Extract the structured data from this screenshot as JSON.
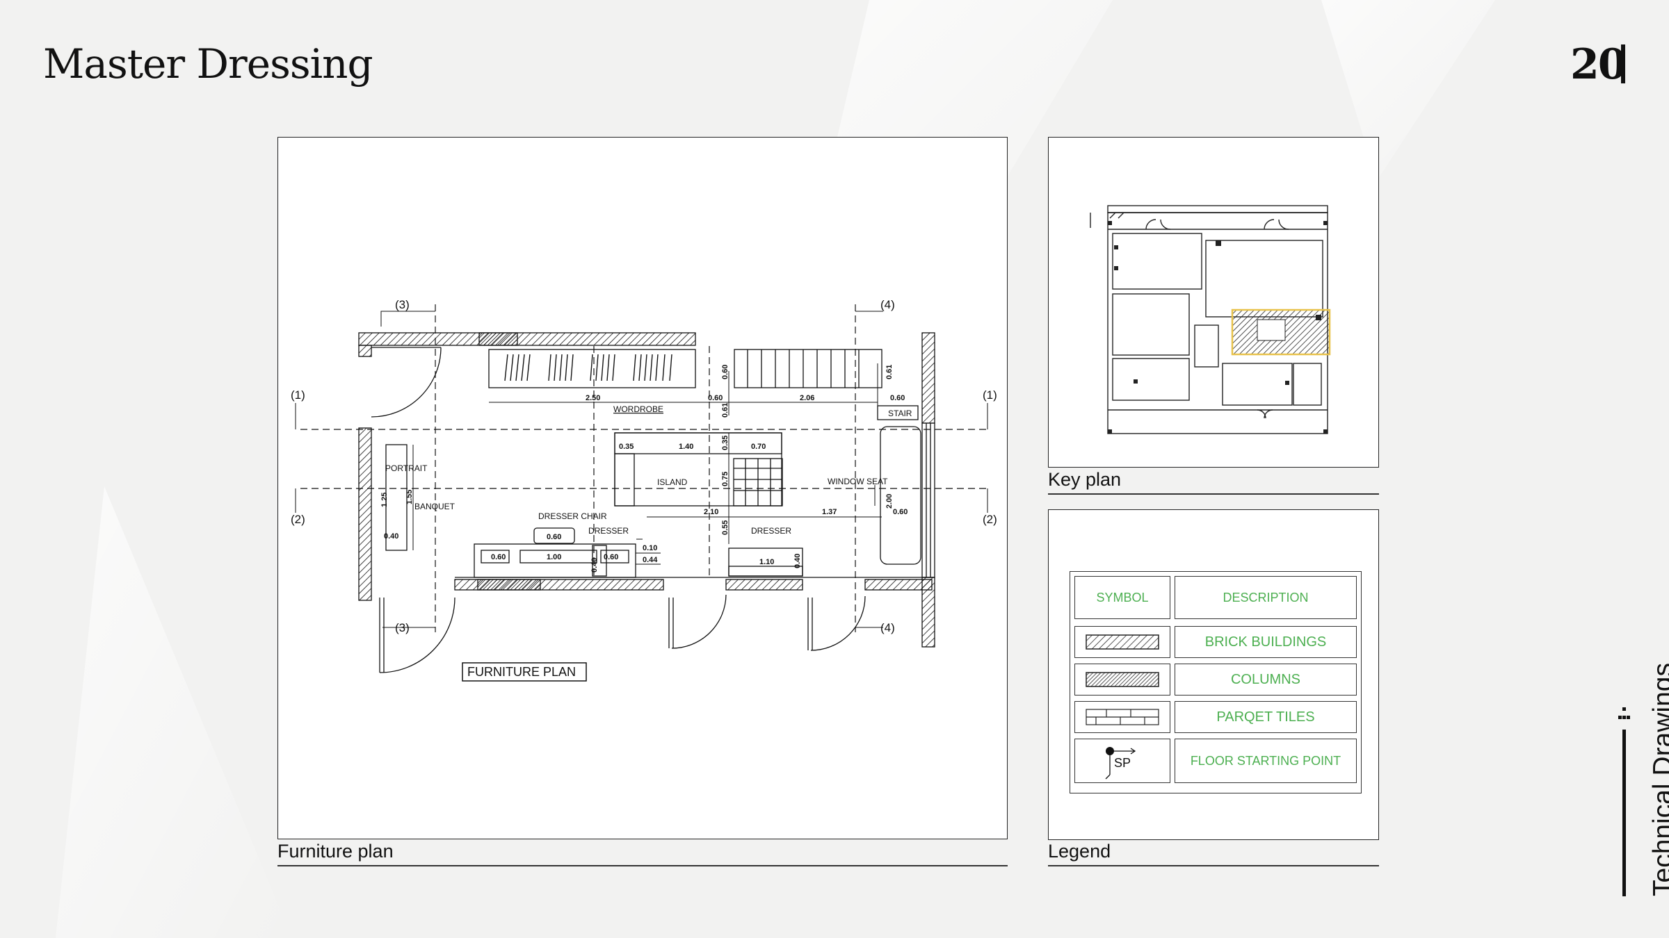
{
  "page": {
    "title": "Master Dressing",
    "page_number": "20",
    "section": "Technical Drawings"
  },
  "furniture_panel": {
    "caption": "Furniture plan",
    "plan_title": "FURNITURE PLAN",
    "section_marks": [
      "(1)",
      "(1)",
      "(2)",
      "(2)",
      "(3)",
      "(3)",
      "(4)",
      "(4)"
    ],
    "labels": {
      "wardrobe": "WORDROBE",
      "stair": "STAIR",
      "island": "ISLAND",
      "window_seat": "WINDOW SEAT",
      "portrait": "PORTRAIT",
      "banquet": "BANQUET",
      "dresser_chair": "DRESSER CHAIR",
      "dresser_left": "DRESSER",
      "dresser_right": "DRESSER"
    },
    "dimensions": {
      "d_250": "2.50",
      "d_060_a": "0.60",
      "d_206": "2.06",
      "d_060_b": "0.60",
      "d_060_v": "0.60",
      "d_061_v": "0.61",
      "d_061_b": "0.61",
      "d_035_v": "0.35",
      "d_035": "0.35",
      "d_140": "1.40",
      "d_070": "0.70",
      "d_075": "0.75",
      "d_210": "2.10",
      "d_137": "1.37",
      "d_055": "0.55",
      "d_060_c": "0.60",
      "d_100": "1.00",
      "d_060_d": "0.60",
      "d_060_e": "0.60",
      "d_040_v": "0.40",
      "d_010": "0.10",
      "d_044": "0.44",
      "d_110": "1.10",
      "d_040_b": "0.40",
      "d_125": "1.25",
      "d_155": "1.55",
      "d_040_c": "0.40",
      "d_200": "2.00",
      "d_060_f": "0.60"
    }
  },
  "key_panel": {
    "caption": "Key plan"
  },
  "legend_panel": {
    "caption": "Legend",
    "header": {
      "symbol": "SYMBOL",
      "description": "DESCRIPTION"
    },
    "rows": [
      {
        "symbol": "hatch-brick",
        "description": "BRICK BUILDINGS"
      },
      {
        "symbol": "hatch-column",
        "description": "COLUMNS"
      },
      {
        "symbol": "parquet-tiles",
        "description": "PARQET TILES"
      },
      {
        "symbol": "start-point",
        "symbol_text": "SP",
        "description": "FLOOR STARTING POINT"
      }
    ]
  },
  "colors": {
    "legend_text": "#4caf50",
    "highlight": "#e8c24a",
    "ink": "#111111"
  }
}
